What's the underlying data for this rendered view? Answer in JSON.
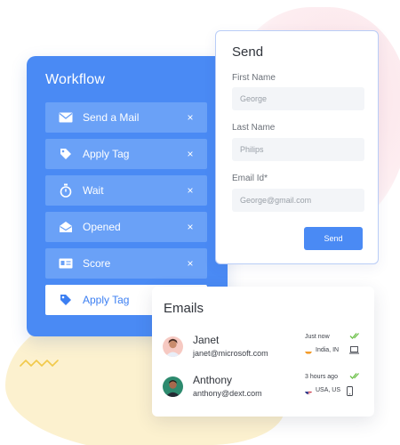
{
  "workflow": {
    "title": "Workflow",
    "items": [
      {
        "label": "Send a Mail",
        "icon": "mail-icon",
        "close": "×"
      },
      {
        "label": "Apply Tag",
        "icon": "tag-icon",
        "close": "×"
      },
      {
        "label": "Wait",
        "icon": "stopwatch-icon",
        "close": "×"
      },
      {
        "label": "Opened",
        "icon": "opened-envelope-icon",
        "close": "×"
      },
      {
        "label": "Score",
        "icon": "id-card-icon",
        "close": "×"
      },
      {
        "label": "Apply Tag",
        "icon": "tag-icon",
        "active": true
      }
    ]
  },
  "send": {
    "title": "Send",
    "first_name_label": "First Name",
    "first_name_placeholder": "George",
    "last_name_label": "Last Name",
    "last_name_placeholder": "Philips",
    "email_label": "Email Id*",
    "email_placeholder": "George@gmail.com",
    "button_label": "Send"
  },
  "emails": {
    "title": "Emails",
    "rows": [
      {
        "name": "Janet",
        "address": "janet@microsoft.com",
        "time": "Just now",
        "location": "India, IN",
        "device": "laptop-icon",
        "flag": "india-flag-icon"
      },
      {
        "name": "Anthony",
        "address": "anthony@dext.com",
        "time": "3 hours ago",
        "location": "USA, US",
        "device": "phone-icon",
        "flag": "usa-flag-icon"
      }
    ]
  },
  "colors": {
    "primary": "#4a8af4",
    "item": "#6aa1f7",
    "check": "#6cc04a",
    "blob_pink": "#fbe0e6",
    "blob_yellow": "#fcf1cf"
  }
}
